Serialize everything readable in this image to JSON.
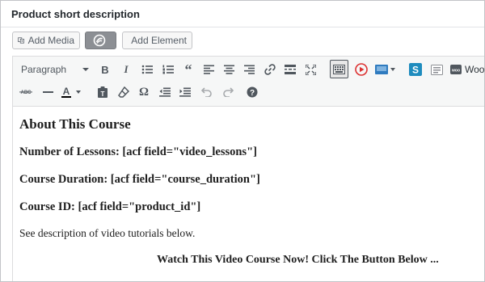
{
  "panel": {
    "title": "Product short description"
  },
  "buttons": {
    "add_media": "Add Media",
    "add_element": "Add Element"
  },
  "toolbar": {
    "format_select": "Paragraph",
    "cutoff_label": "Woo"
  },
  "content": {
    "heading": "About This Course",
    "line1": "Number of Lessons: [acf field=\"video_lessons\"]",
    "line2": "Course Duration: [acf field=\"course_duration\"]",
    "line3": "Course ID: [acf field=\"product_id\"]",
    "note": "See description of video tutorials below.",
    "cta": "Watch This Video Course Now! Click The Button Below ..."
  }
}
